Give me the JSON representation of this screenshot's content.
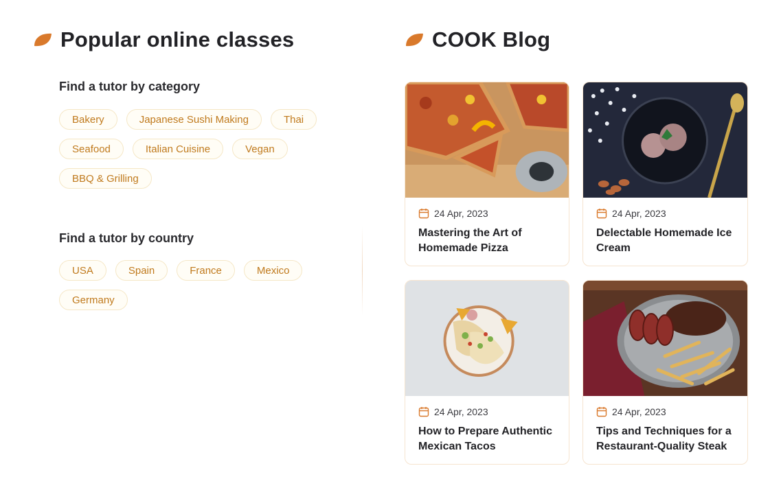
{
  "classes": {
    "title": "Popular online classes",
    "category_heading": "Find a tutor by category",
    "categories": [
      "Bakery",
      "Japanese Sushi Making",
      "Thai",
      "Seafood",
      "Italian Cuisine",
      "Vegan",
      "BBQ & Grilling"
    ],
    "country_heading": "Find a tutor by country",
    "countries": [
      "USA",
      "Spain",
      "France",
      "Mexico",
      "Germany"
    ]
  },
  "blog": {
    "title": "COOK Blog",
    "posts": [
      {
        "date": "24 Apr, 2023",
        "title": "Mastering the Art of Homemade Pizza",
        "image": "pizza-photo"
      },
      {
        "date": "24 Apr, 2023",
        "title": "Delectable Homemade Ice Cream",
        "image": "ice-cream-photo"
      },
      {
        "date": "24 Apr, 2023",
        "title": "How to Prepare Authentic Mexican Tacos",
        "image": "tacos-photo"
      },
      {
        "date": "24 Apr, 2023",
        "title": "Tips and Techniques for a Restaurant-Quality Steak",
        "image": "steak-photo"
      }
    ]
  },
  "colors": {
    "accent": "#d9792b",
    "tag_text": "#c07a1d",
    "tag_border": "#f5e7c6",
    "card_border": "#f6e4cf"
  },
  "icons": {
    "section": "leaf-icon",
    "date": "calendar-icon"
  }
}
